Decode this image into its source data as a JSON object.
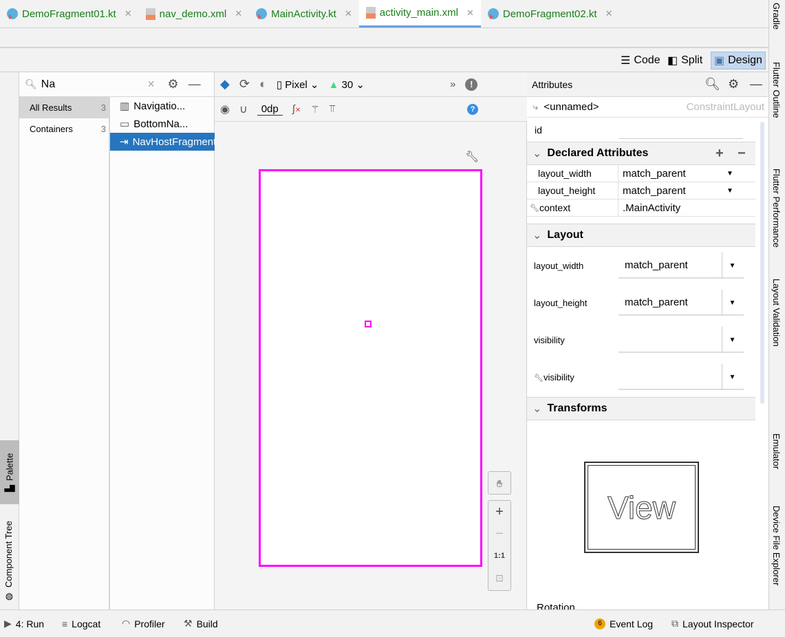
{
  "tabs": [
    {
      "label": "DemoFragment01.kt",
      "type": "kotlin"
    },
    {
      "label": "nav_demo.xml",
      "type": "xml"
    },
    {
      "label": "MainActivity.kt",
      "type": "kotlin"
    },
    {
      "label": "activity_main.xml",
      "type": "xml",
      "active": true
    },
    {
      "label": "DemoFragment02.kt",
      "type": "kotlin"
    }
  ],
  "view_modes": {
    "code": "Code",
    "split": "Split",
    "design": "Design",
    "selected": "Design"
  },
  "palette": {
    "search_value": "Na",
    "categories": [
      {
        "label": "All Results",
        "count": "3"
      },
      {
        "label": "Containers",
        "count": "3"
      }
    ],
    "results": [
      "Navigatio...",
      "BottomNa...",
      "NavHostFragment"
    ],
    "selected_result": "NavHostFragment"
  },
  "left_tools": {
    "palette": "Palette",
    "component_tree": "Component Tree"
  },
  "design_toolbar": {
    "device": "Pixel",
    "api": "30",
    "margin": "0dp"
  },
  "zoom_panel": {
    "one_to_one": "1:1"
  },
  "attributes": {
    "title": "Attributes",
    "component_name": "<unnamed>",
    "component_type": "ConstraintLayout",
    "id_label": "id",
    "declared_title": "Declared Attributes",
    "declared": [
      {
        "key": "layout_width",
        "value": "match_parent"
      },
      {
        "key": "layout_height",
        "value": "match_parent"
      },
      {
        "key": "context",
        "value": ".MainActivity"
      }
    ],
    "layout_title": "Layout",
    "layout": [
      {
        "key": "layout_width",
        "value": "match_parent"
      },
      {
        "key": "layout_height",
        "value": "match_parent"
      },
      {
        "key": "visibility",
        "value": ""
      },
      {
        "key": "visibility",
        "value": ""
      }
    ],
    "transforms_title": "Transforms",
    "preview_text": "View",
    "rotation_label": "Rotation"
  },
  "right_tools": [
    "Gradle",
    "Flutter Outline",
    "Flutter Performance",
    "Layout Validation",
    "Emulator",
    "Device File Explorer"
  ],
  "bottom_bar": {
    "run": "4: Run",
    "logcat": "Logcat",
    "profiler": "Profiler",
    "build": "Build",
    "event_log_count": "6",
    "event_log": "Event Log",
    "layout_inspector": "Layout Inspector"
  },
  "colors": {
    "accent": "#2675bf",
    "selection_frame": "#ff00ff",
    "tab_text": "#1a7f1a"
  }
}
